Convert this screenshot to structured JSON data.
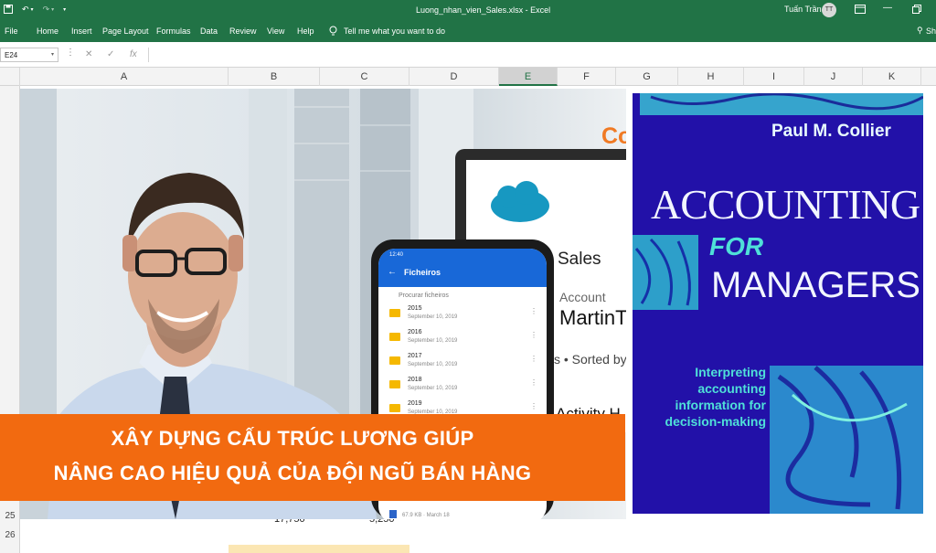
{
  "titlebar": {
    "filename": "Luong_nhan_vien_Sales.xlsx",
    "app": "Excel",
    "separator": "-",
    "user": "Tuấn Trần",
    "avatar_initials": "TT",
    "accent": "#217346"
  },
  "ribbon": {
    "tabs": [
      "File",
      "Home",
      "Insert",
      "Page Layout",
      "Formulas",
      "Data",
      "Review",
      "View",
      "Help"
    ],
    "tell_me": "Tell me what you want to do",
    "share": "Sh"
  },
  "formula_bar": {
    "name_box": "E24",
    "fx": "fx"
  },
  "columns": [
    "A",
    "B",
    "C",
    "D",
    "E",
    "F",
    "G",
    "H",
    "I",
    "J",
    "K"
  ],
  "selected_column": "E",
  "rows": [
    "25",
    "26"
  ],
  "cells": {
    "b25": "17,750",
    "c25": "5,250"
  },
  "phone": {
    "time": "12:40",
    "title": "Ficheiros",
    "search": "Procurar ficheiros",
    "folders": [
      {
        "name": "2015",
        "date": "September 10, 2019"
      },
      {
        "name": "2016",
        "date": "September 10, 2019"
      },
      {
        "name": "2017",
        "date": "September 10, 2019"
      },
      {
        "name": "2018",
        "date": "September 10, 2019"
      },
      {
        "name": "2019",
        "date": "September 10, 2019"
      }
    ],
    "file_meta": "67.9 KB · March 18"
  },
  "laptop": {
    "sales": "Sales",
    "account": "Account",
    "account_name": "MartinTo",
    "sorted": "s • Sorted by",
    "activity": "Activity H",
    "corner": "Co"
  },
  "book": {
    "author": "Paul M. Collier",
    "title_1": "ACCOUNTING",
    "title_for": "FOR",
    "title_2": "MANAGERS",
    "subtitle": [
      "Interpreting",
      "accounting",
      "information for",
      "decision-making"
    ],
    "bg": "#2211a8",
    "text_color": "#e8fbff",
    "accent": "#4fe0d8"
  },
  "banner": {
    "line1": "XÂY DỰNG CẤU TRÚC LƯƠNG GIÚP",
    "line2": "NÂNG CAO HIỆU QUẢ CỦA ĐỘI NGŨ BÁN HÀNG",
    "color": "#f26a10"
  }
}
